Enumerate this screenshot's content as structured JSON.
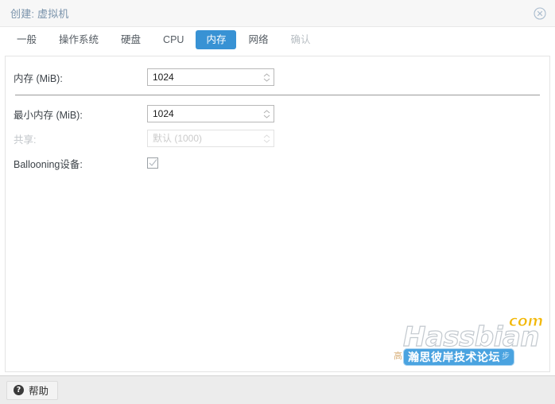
{
  "window": {
    "title": "创建: 虚拟机",
    "close_icon": "close-circle-icon"
  },
  "tabs": [
    {
      "label": "一般",
      "state": "normal"
    },
    {
      "label": "操作系统",
      "state": "normal"
    },
    {
      "label": "硬盘",
      "state": "normal"
    },
    {
      "label": "CPU",
      "state": "normal"
    },
    {
      "label": "内存",
      "state": "active"
    },
    {
      "label": "网络",
      "state": "normal"
    },
    {
      "label": "确认",
      "state": "disabled"
    }
  ],
  "form": {
    "memory": {
      "label": "内存 (MiB):",
      "value": "1024",
      "spinner_icon": "spinner-arrows-icon"
    },
    "min_memory": {
      "label": "最小内存 (MiB):",
      "value": "1024",
      "spinner_icon": "spinner-arrows-icon"
    },
    "shares": {
      "label": "共享:",
      "placeholder": "默认 (1000)",
      "value": "",
      "disabled": true,
      "spinner_icon": "spinner-arrows-icon"
    },
    "ballooning": {
      "label": "Ballooning设备:",
      "checked": true,
      "check_icon": "check-icon"
    }
  },
  "toolbar": {
    "help_label": "帮助",
    "help_icon": "question-mark-icon"
  },
  "watermark": {
    "brand": "Hassbian",
    "tld": "com",
    "badge_text": "瀚思彼岸技术论坛",
    "badge_extra": "步",
    "behind_text": "高"
  },
  "colors": {
    "accent": "#3892d4",
    "title_text": "#7a93ab",
    "watermark_badge": "#4aa3e0",
    "watermark_tld": "#f2b705"
  }
}
